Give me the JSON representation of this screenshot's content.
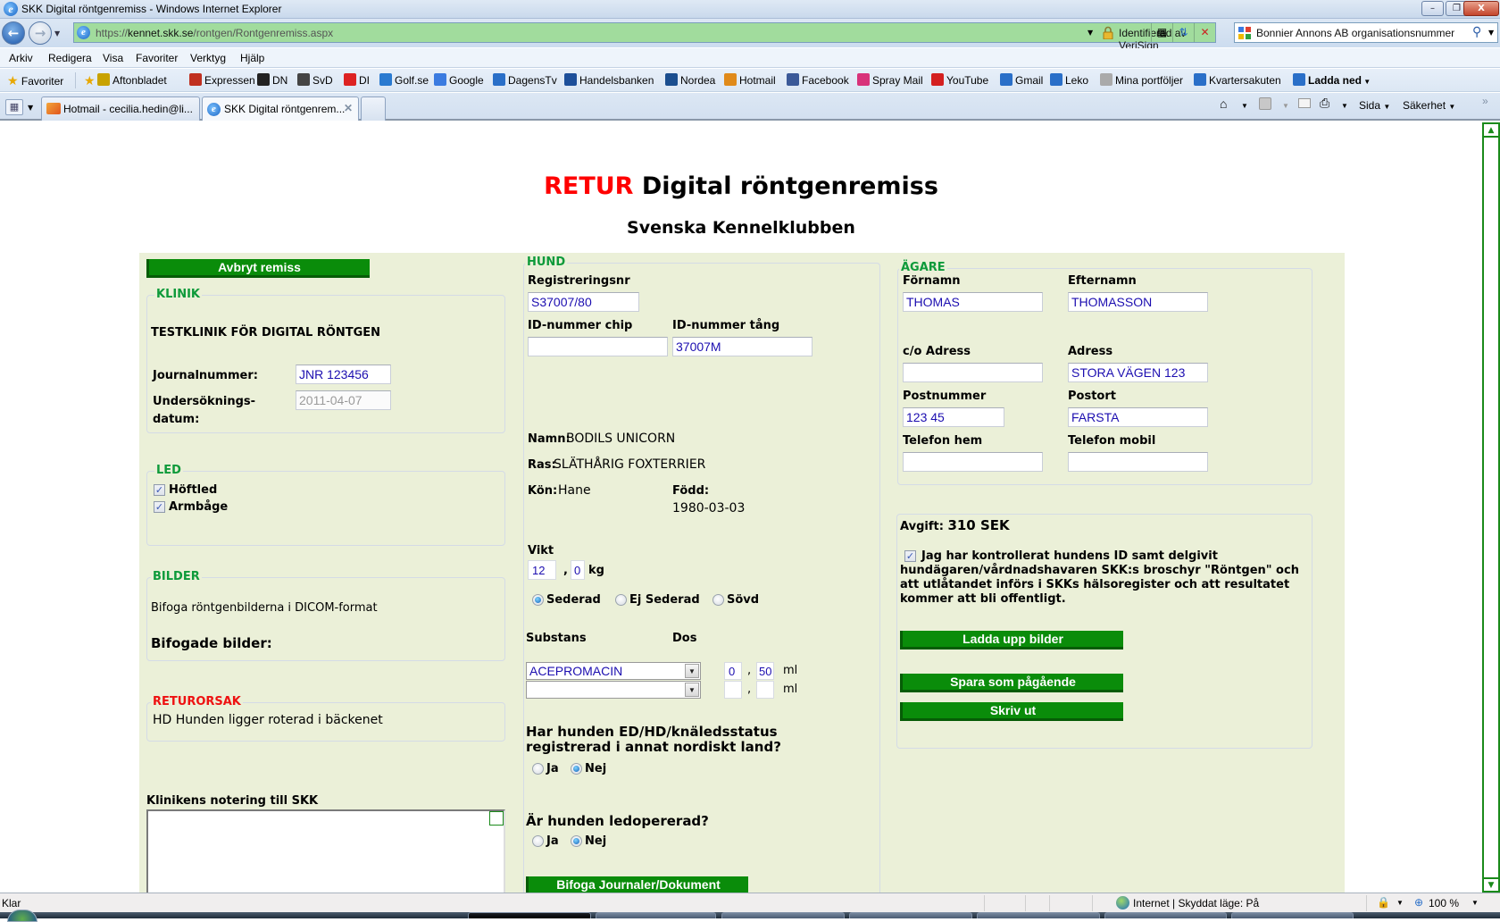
{
  "window": {
    "title": "SKK Digital röntgenremiss - Windows Internet Explorer",
    "minimize": "–",
    "restore": "❐",
    "close": "X"
  },
  "address_bar": {
    "url_prefix": "https://",
    "url_host": "kennet.skk.se",
    "url_path": "/rontgen/Rontgenremiss.aspx",
    "security_label": "Identifierad av VeriSign",
    "search_text": "Bonnier Annons AB organisationsnummer"
  },
  "menu": {
    "items": [
      "Arkiv",
      "Redigera",
      "Visa",
      "Favoriter",
      "Verktyg",
      "Hjälp"
    ]
  },
  "favorites_bar": {
    "favorites_label": "Favoriter",
    "links": [
      {
        "label": "Aftonbladet",
        "icon": "aftonbladet-icon",
        "color": "#c8a200"
      },
      {
        "label": "Expressen",
        "icon": "expressen-icon",
        "color": "#c03020"
      },
      {
        "label": "DN",
        "icon": "dn-icon",
        "color": "#222222"
      },
      {
        "label": "SvD",
        "icon": "svd-icon",
        "color": "#444444"
      },
      {
        "label": "DI",
        "icon": "di-icon",
        "color": "#dd2222"
      },
      {
        "label": "Golf.se",
        "icon": "golf-icon",
        "color": "#2a7ad0"
      },
      {
        "label": "Google",
        "icon": "google-icon",
        "color": "#3b7be0"
      },
      {
        "label": "DagensTv",
        "icon": "ie-page-icon",
        "color": "#2a6fc8"
      },
      {
        "label": "Handelsbanken",
        "icon": "handelsbanken-icon",
        "color": "#1d4f9a"
      },
      {
        "label": "Nordea",
        "icon": "nordea-icon",
        "color": "#1b4e8f"
      },
      {
        "label": "Hotmail",
        "icon": "windows-flag-icon",
        "color": "#e08a1a"
      },
      {
        "label": "Facebook",
        "icon": "facebook-icon",
        "color": "#3b5998"
      },
      {
        "label": "Spray Mail",
        "icon": "spray-icon",
        "color": "#d8327a"
      },
      {
        "label": "YouTube",
        "icon": "youtube-icon",
        "color": "#d42020"
      },
      {
        "label": "Gmail",
        "icon": "ie-page-icon",
        "color": "#2a6fc8"
      },
      {
        "label": "Leko",
        "icon": "ie-page-icon",
        "color": "#2a6fc8"
      },
      {
        "label": "Mina portföljer",
        "icon": "grid-icon",
        "color": "#aaaaaa"
      },
      {
        "label": "Kvartersakuten",
        "icon": "ie-page-icon",
        "color": "#2a6fc8"
      },
      {
        "label": "Ladda ned",
        "icon": "ie-page-icon",
        "color": "#2a6fc8"
      }
    ]
  },
  "tabs": [
    {
      "label": "Hotmail - cecilia.hedin@li...",
      "active": false
    },
    {
      "label": "SKK Digital röntgenrem...",
      "active": true
    }
  ],
  "command_bar": {
    "page_label": "Sida",
    "security_label": "Säkerhet"
  },
  "page": {
    "title_prefix": "RETUR",
    "title": "Digital röntgenremiss",
    "subtitle": "Svenska Kennelklubben",
    "cancel_button": "Avbryt remiss",
    "klinik": {
      "legend": "KLINIK",
      "clinic_name": "TESTKLINIK FÖR DIGITAL RÖNTGEN",
      "journal_label": "Journalnummer:",
      "journal_value": "JNR 123456",
      "exam_date_label_1": "Undersöknings-",
      "exam_date_label_2": "datum:",
      "exam_date_value": "2011-04-07"
    },
    "led": {
      "legend": "LED",
      "options": [
        {
          "label": "Höftled",
          "checked": true
        },
        {
          "label": "Armbåge",
          "checked": true
        }
      ]
    },
    "bilder": {
      "legend": "BILDER",
      "instruction": "Bifoga röntgenbilderna i DICOM-format",
      "attached_label": "Bifogade bilder:"
    },
    "returorsak": {
      "legend": "RETURORSAK",
      "reason": "HD Hunden ligger roterad i bäckenet"
    },
    "clinic_note": {
      "label": "Klinikens notering till SKK",
      "value": ""
    },
    "hund": {
      "legend": "HUND",
      "reg_label": "Registreringsnr",
      "reg_value": "S37007/80",
      "chip_label": "ID-nummer chip",
      "chip_value": "",
      "tang_label": "ID-nummer tång",
      "tang_value": "37007M",
      "name_label": "Namn:",
      "name_value": "BODILS UNICORN",
      "breed_label": "Ras:",
      "breed_value": "SLÄTHÅRIG FOXTERRIER",
      "sex_label": "Kön:",
      "sex_value": "Hane",
      "born_label": "Född:",
      "born_value": "1980-03-03",
      "weight_label": "Vikt",
      "weight_int": "12",
      "weight_dec": "0",
      "weight_unit": "kg",
      "sedation": [
        {
          "label": "Sederad",
          "selected": true
        },
        {
          "label": "Ej Sederad",
          "selected": false
        },
        {
          "label": "Sövd",
          "selected": false
        }
      ],
      "substance_label": "Substans",
      "dose_label": "Dos",
      "substances": [
        {
          "value": "ACEPROMACIN",
          "dose_int": "0",
          "dose_dec": "50",
          "unit": "ml"
        },
        {
          "value": "",
          "dose_int": "",
          "dose_dec": "",
          "unit": "ml"
        }
      ],
      "nordic_question": "Har hunden ED/HD/knäledsstatus registrerad i annat nordiskt land?",
      "nordic_options": [
        {
          "label": "Ja",
          "selected": false
        },
        {
          "label": "Nej",
          "selected": true
        }
      ],
      "operated_question": "Är hunden ledopererad?",
      "operated_options": [
        {
          "label": "Ja",
          "selected": false
        },
        {
          "label": "Nej",
          "selected": true
        }
      ],
      "attach_docs_button": "Bifoga Journaler/Dokument"
    },
    "agare": {
      "legend": "ÄGARE",
      "firstname_label": "Förnamn",
      "firstname_value": "THOMAS",
      "lastname_label": "Efternamn",
      "lastname_value": "THOMASSON",
      "co_label": "c/o Adress",
      "co_value": "",
      "address_label": "Adress",
      "address_value": "STORA VÄGEN 123",
      "zip_label": "Postnummer",
      "zip_value": "123 45",
      "city_label": "Postort",
      "city_value": "FARSTA",
      "phone_home_label": "Telefon hem",
      "phone_home_value": "",
      "phone_mobile_label": "Telefon mobil",
      "phone_mobile_value": ""
    },
    "summary": {
      "fee_label": "Avgift:",
      "fee_value": "310 SEK",
      "consent_checked": true,
      "consent_text": "Jag har kontrollerat hundens ID samt delgivit hundägaren/vårdnadshavaren SKK:s broschyr \"Röntgen\" och att utlåtandet införs i SKKs hälsoregister och att resultatet kommer att bli offentligt.",
      "upload_button": "Ladda upp bilder",
      "save_button": "Spara som pågående",
      "print_button": "Skriv ut"
    }
  },
  "status_bar": {
    "status": "Klar",
    "zone": "Internet | Skyddat läge: På",
    "zoom": "100 %"
  }
}
